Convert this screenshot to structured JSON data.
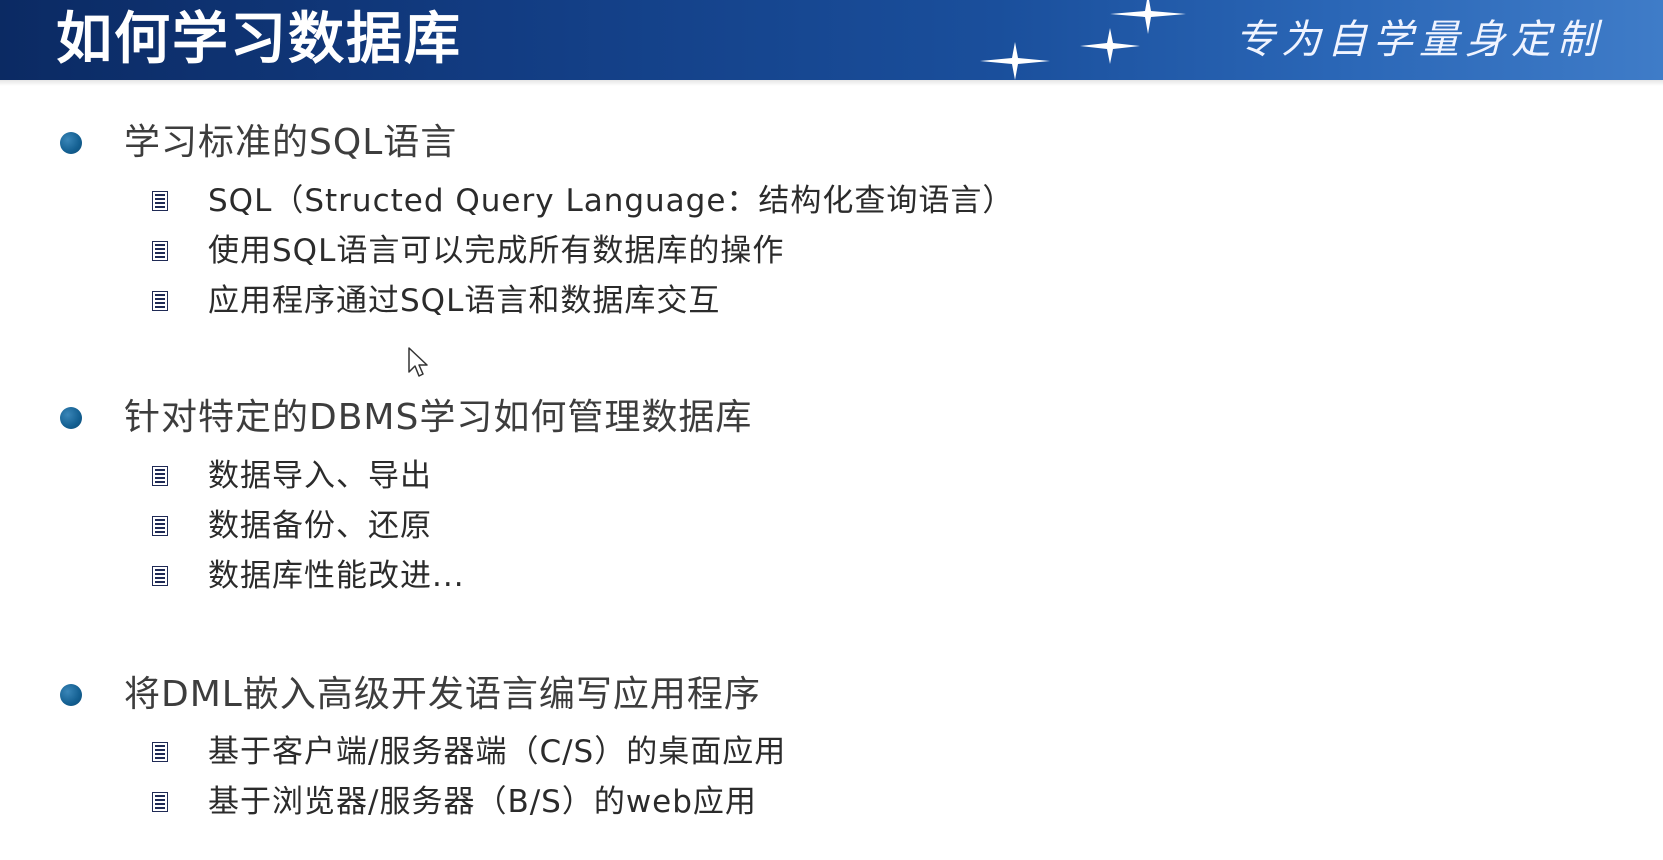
{
  "header": {
    "title": "如何学习数据库",
    "slogan": "专为自学量身定制"
  },
  "sections": [
    {
      "title": "学习标准的SQL语言",
      "items": [
        "SQL（Structed Query Language：结构化查询语言）",
        "使用SQL语言可以完成所有数据库的操作",
        "应用程序通过SQL语言和数据库交互"
      ]
    },
    {
      "title": "针对特定的DBMS学习如何管理数据库",
      "items": [
        "数据导入、导出",
        "数据备份、还原",
        "数据库性能改进..."
      ]
    },
    {
      "title": "将DML嵌入高级开发语言编写应用程序",
      "items": [
        "基于客户端/服务器端（C/S）的桌面应用",
        "基于浏览器/服务器（B/S）的web应用"
      ]
    }
  ],
  "icons": {
    "section_bullet": "circle-bullet-icon",
    "item_bullet": "document-list-icon",
    "cursor": "mouse-pointer-icon",
    "decoration": "sparkle-star-icon"
  },
  "colors": {
    "header_dark": "#0b2a63",
    "header_light": "#3f7cc8",
    "bullet": "#135f91",
    "text": "#2b2b2b"
  }
}
